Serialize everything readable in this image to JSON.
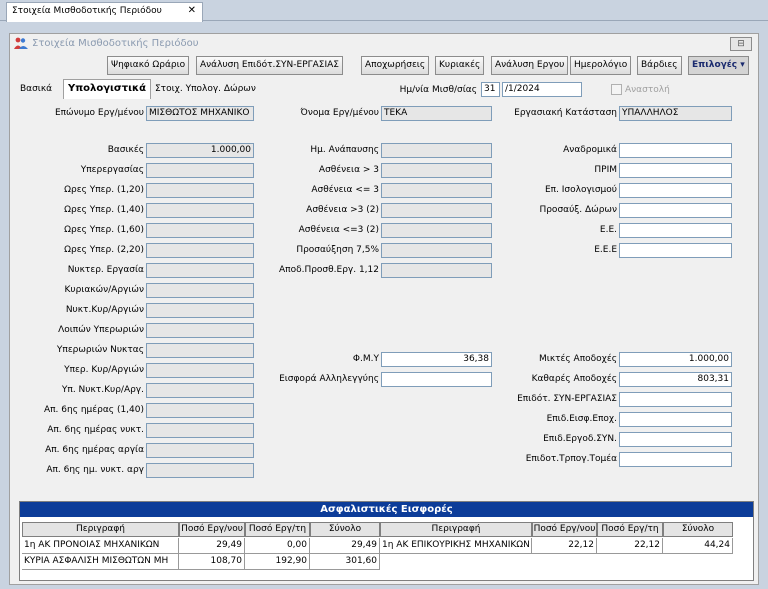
{
  "doc_tab": {
    "label": "Στοιχεία Μισθοδοτικής Περιόδου",
    "close": "✕"
  },
  "window": {
    "title": "Στοιχεία Μισθοδοτικής Περιόδου",
    "min": "⊟"
  },
  "toolbar": {
    "buttons": [
      "Ψηφιακό Ωράριο",
      "Ανάλυση Επιδότ.ΣΥΝ-ΕΡΓΑΣΙΑΣ",
      "Αποχωρήσεις",
      "Κυριακές",
      "Ανάλυση Εργου",
      "Ημερολόγιο",
      "Βάρδιες"
    ],
    "options": "Επιλογές ▾"
  },
  "tabs": [
    "Βασικά",
    "Υπολογιστικά",
    "Στοιχ. Υπολογ. Δώρων"
  ],
  "period": {
    "label": "Ημ/νία Μισθ/σίας",
    "day": "31",
    "date": "/1/2024",
    "suspend_label": "Αναστολή"
  },
  "header_fields": {
    "surname_label": "Επώνυμο Εργ/μένου",
    "surname": "ΜΙΣΘΩΤΟΣ ΜΗΧΑΝΙΚΟ",
    "name_label": "Όνομα Εργ/μένου",
    "name": "ΤΕΚΑ",
    "status_label": "Εργασιακή Κατάσταση",
    "status": "ΥΠΑΛΛΗΛΟΣ"
  },
  "col1": [
    {
      "label": "Βασικές",
      "value": "1.000,00"
    },
    {
      "label": "Υπερεργασίας",
      "value": ""
    },
    {
      "label": "Ωρες Υπερ. (1,20)",
      "value": ""
    },
    {
      "label": "Ωρες Υπερ. (1,40)",
      "value": ""
    },
    {
      "label": "Ωρες Υπερ. (1,60)",
      "value": ""
    },
    {
      "label": "Ωρες Υπερ. (2,20)",
      "value": ""
    },
    {
      "label": "Νυκτερ. Εργασία",
      "value": ""
    },
    {
      "label": "Κυριακών/Αργιών",
      "value": ""
    },
    {
      "label": "Νυκτ.Κυρ/Αργιών",
      "value": ""
    },
    {
      "label": "Λοιπών Υπερωριών",
      "value": ""
    },
    {
      "label": "Υπερωριών Νυκτας",
      "value": ""
    },
    {
      "label": "Υπερ. Κυρ/Αργιών",
      "value": ""
    },
    {
      "label": "Υπ. Νυκτ.Κυρ/Αργ.",
      "value": ""
    },
    {
      "label": "Απ. 6ης ημέρας (1,40)",
      "value": ""
    },
    {
      "label": "Απ. 6ης ημέρας νυκτ.",
      "value": ""
    },
    {
      "label": "Απ. 6ης ημέρας αργία",
      "value": ""
    },
    {
      "label": "Απ. 6ης ημ. νυκτ. αργ",
      "value": ""
    }
  ],
  "col2": [
    {
      "label": "Ημ. Ανάπαυσης",
      "value": ""
    },
    {
      "label": "Ασθένεια > 3",
      "value": ""
    },
    {
      "label": "Ασθένεια <= 3",
      "value": ""
    },
    {
      "label": "Ασθένεια >3 (2)",
      "value": ""
    },
    {
      "label": "Ασθένεια <=3 (2)",
      "value": ""
    },
    {
      "label": "Προσαύξηση 7,5%",
      "value": ""
    },
    {
      "label": "Αποδ.Προσθ.Εργ. 1,12",
      "value": ""
    }
  ],
  "col2b": [
    {
      "label": "Φ.Μ.Υ",
      "value": "36,38"
    },
    {
      "label": "Εισφορά Αλληλεγγύης",
      "value": ""
    }
  ],
  "col3": [
    {
      "label": "Αναδρομικά",
      "value": ""
    },
    {
      "label": "ΠΡΙΜ",
      "value": ""
    },
    {
      "label": "Επ. Ισολογισμού",
      "value": ""
    },
    {
      "label": "Προσαύξ. Δώρων",
      "value": ""
    },
    {
      "label": "Ε.Ε.",
      "value": ""
    },
    {
      "label": "Ε.Ε.Ε",
      "value": ""
    }
  ],
  "col3b": [
    {
      "label": "Μικτές Αποδοχές",
      "value": "1.000,00"
    },
    {
      "label": "Καθαρές Αποδοχές",
      "value": "803,31"
    },
    {
      "label": "Επιδότ. ΣΥΝ-ΕΡΓΑΣΙΑΣ",
      "value": ""
    },
    {
      "label": "Επιδ.Εισφ.Εποχ.",
      "value": ""
    },
    {
      "label": "Επιδ.Εργοδ.ΣΥΝ.",
      "value": ""
    },
    {
      "label": "Επιδοτ.Τρπογ.Τομέα",
      "value": ""
    }
  ],
  "insurance": {
    "title": "Ασφαλιστικές Εισφορές",
    "headers": [
      "Περιγραφή",
      "Ποσό Εργ/νου",
      "Ποσό Εργ/τη",
      "Σύνολο",
      "Περιγραφή",
      "Ποσό Εργ/νου",
      "Ποσό Εργ/τη",
      "Σύνολο"
    ],
    "left_rows": [
      [
        "1η ΑΚ ΠΡΟΝΟΙΑΣ ΜΗΧΑΝΙΚΩΝ",
        "29,49",
        "0,00",
        "29,49"
      ],
      [
        "ΚΥΡΙΑ ΑΣΦΑΛΙΣΗ ΜΙΣΘΩΤΩΝ ΜΗ",
        "108,70",
        "192,90",
        "301,60"
      ]
    ],
    "right_rows": [
      [
        "1η ΑΚ ΕΠΙΚΟΥΡΙΚΗΣ ΜΗΧΑΝΙΚΩΝ",
        "22,12",
        "22,12",
        "44,24"
      ]
    ]
  }
}
